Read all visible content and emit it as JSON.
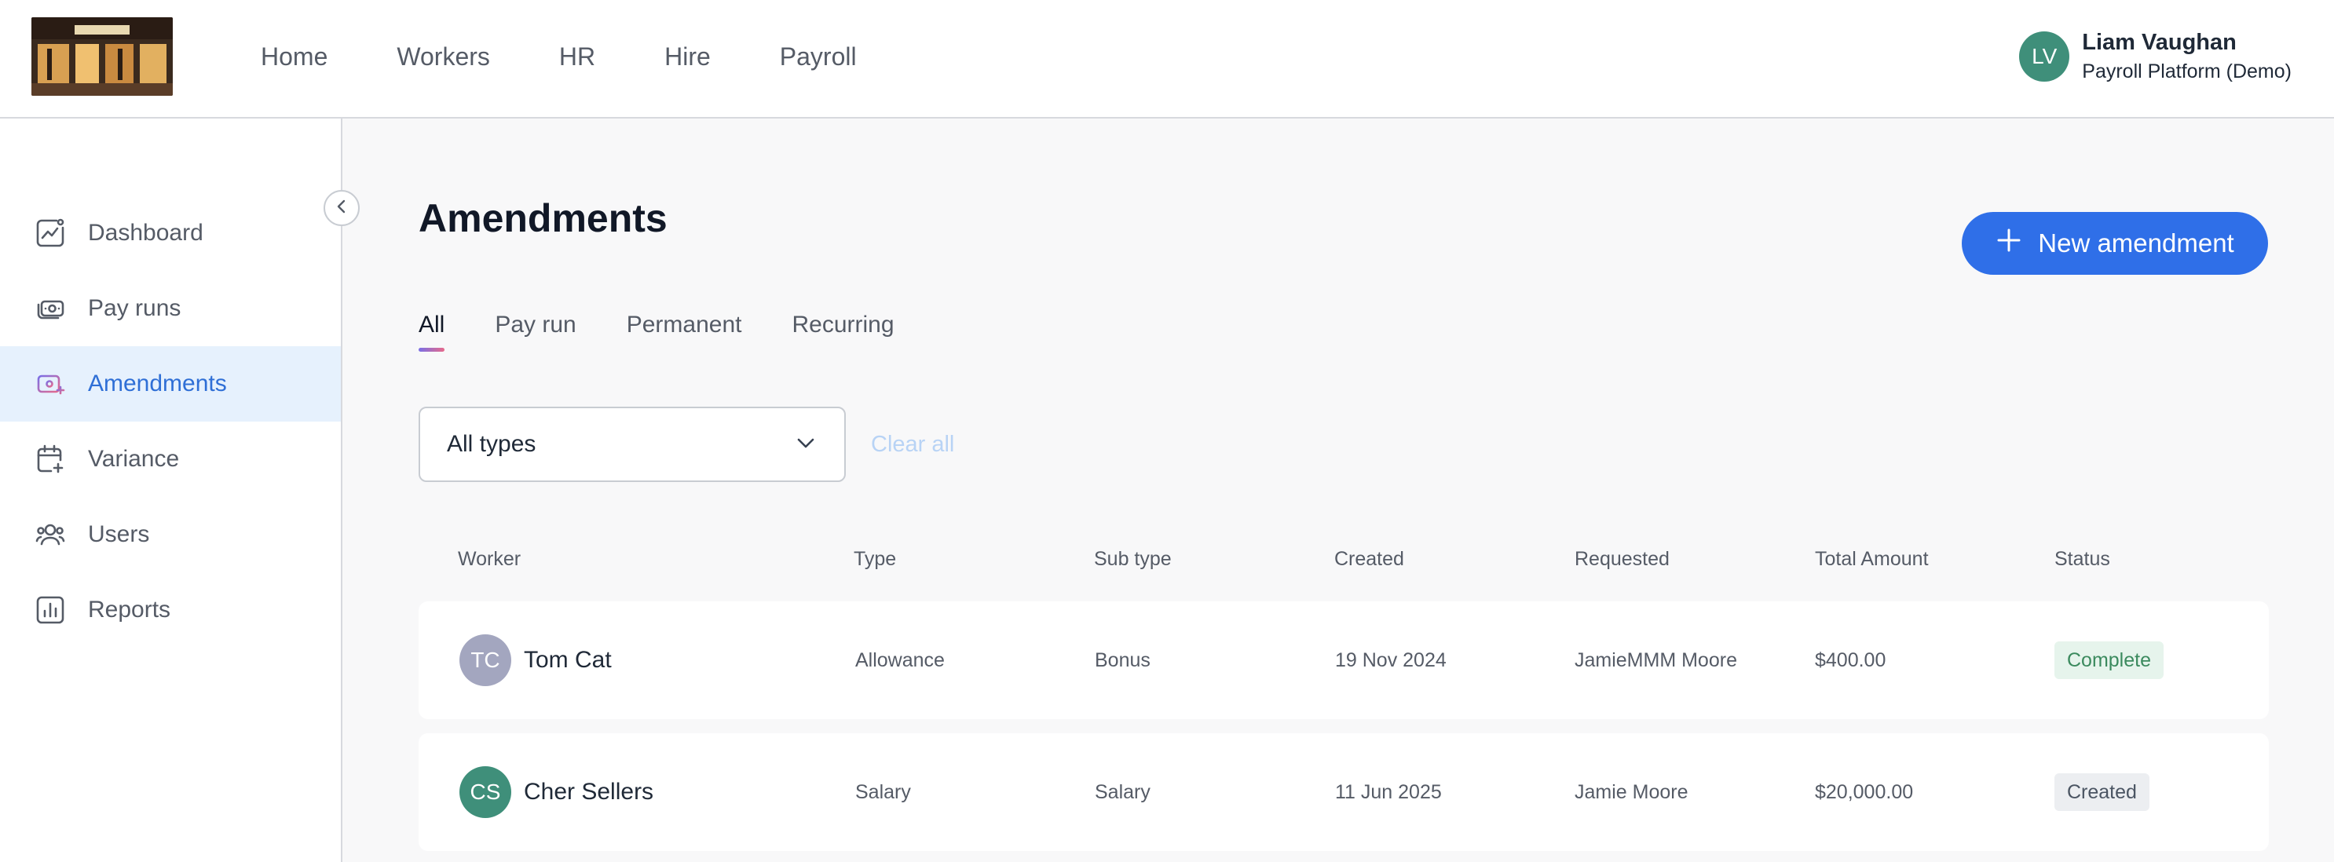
{
  "header": {
    "nav": [
      "Home",
      "Workers",
      "HR",
      "Hire",
      "Payroll"
    ],
    "user": {
      "initials": "LV",
      "name": "Liam Vaughan",
      "subtitle": "Payroll Platform (Demo)"
    }
  },
  "sidebar": {
    "items": [
      {
        "label": "Dashboard",
        "icon": "dashboard-icon",
        "active": false
      },
      {
        "label": "Pay runs",
        "icon": "pay-runs-icon",
        "active": false
      },
      {
        "label": "Amendments",
        "icon": "amendments-icon",
        "active": true
      },
      {
        "label": "Variance",
        "icon": "variance-icon",
        "active": false
      },
      {
        "label": "Users",
        "icon": "users-icon",
        "active": false
      },
      {
        "label": "Reports",
        "icon": "reports-icon",
        "active": false
      }
    ]
  },
  "main": {
    "title": "Amendments",
    "new_button_label": "New amendment",
    "tabs": [
      "All",
      "Pay run",
      "Permanent",
      "Recurring"
    ],
    "active_tab": "All",
    "filter": {
      "selected": "All types"
    },
    "clear_all_label": "Clear all",
    "table": {
      "columns": [
        "Worker",
        "Type",
        "Sub type",
        "Created",
        "Requested",
        "Total Amount",
        "Status"
      ],
      "rows": [
        {
          "initials": "TC",
          "worker": "Tom Cat",
          "type": "Allowance",
          "subtype": "Bonus",
          "created": "19 Nov 2024",
          "requested": "JamieMMM Moore",
          "amount": "$400.00",
          "status": "Complete"
        },
        {
          "initials": "CS",
          "worker": "Cher Sellers",
          "type": "Salary",
          "subtype": "Salary",
          "created": "11 Jun 2025",
          "requested": "Jamie Moore",
          "amount": "$20,000.00",
          "status": "Created"
        }
      ]
    }
  },
  "colors": {
    "accent": "#2f6fe8",
    "sidebar_active_bg": "#e6f1fd",
    "sidebar_active_text": "#2f6fd6",
    "avatar_tc": "#a3a6bf",
    "avatar_cs": "#3f8f7a",
    "status_complete_bg": "#e6f4ec",
    "status_complete_text": "#3b8a5e",
    "status_created_bg": "#eceef1",
    "status_created_text": "#4b5563"
  }
}
